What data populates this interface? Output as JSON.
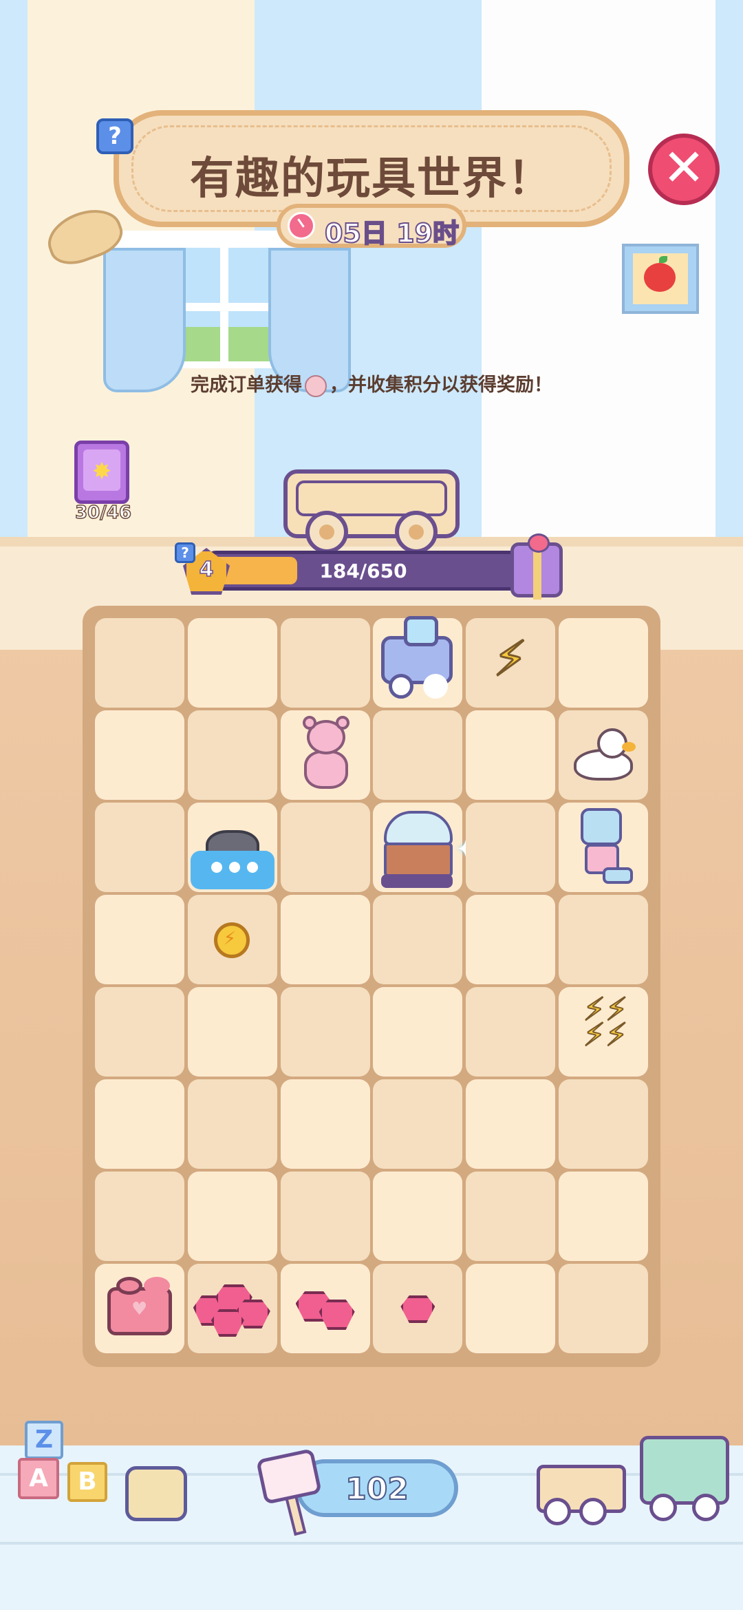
{
  "event": {
    "title": "有趣的玩具世界！",
    "timer": "05日 19时",
    "hint_before": "完成订单获得",
    "hint_after": "，并收集积分以获得奖励！",
    "help_label": "?",
    "close_label": "✕"
  },
  "collection": {
    "count": "30/46"
  },
  "progress": {
    "level": "4",
    "current": 184,
    "total": 650,
    "text": "184/650",
    "fraction": 0.283
  },
  "board": {
    "rows": 8,
    "cols": 6,
    "items": [
      {
        "row": 0,
        "col": 3,
        "type": "train-icon"
      },
      {
        "row": 0,
        "col": 4,
        "type": "lightning-icon"
      },
      {
        "row": 1,
        "col": 2,
        "type": "teddy-bear-icon"
      },
      {
        "row": 1,
        "col": 5,
        "type": "rubber-duck-icon"
      },
      {
        "row": 2,
        "col": 1,
        "type": "bath-toy-icon"
      },
      {
        "row": 2,
        "col": 3,
        "type": "toy-chest-icon"
      },
      {
        "row": 2,
        "col": 5,
        "type": "robot-icon"
      },
      {
        "row": 3,
        "col": 1,
        "type": "energy-coin-icon"
      },
      {
        "row": 4,
        "col": 5,
        "type": "lightning-pile-icon"
      },
      {
        "row": 7,
        "col": 0,
        "type": "lego-brick-icon"
      },
      {
        "row": 7,
        "col": 1,
        "type": "gem-cluster-large-icon"
      },
      {
        "row": 7,
        "col": 2,
        "type": "gem-cluster-medium-icon"
      },
      {
        "row": 7,
        "col": 3,
        "type": "gem-small-icon"
      }
    ]
  },
  "hammer": {
    "count": "102"
  },
  "blocks": {
    "z": "Z",
    "a": "A",
    "b": "B"
  },
  "colors": {
    "accent": "#6a4f8f",
    "progress": "#f6b44a",
    "close": "#ef4d72"
  }
}
